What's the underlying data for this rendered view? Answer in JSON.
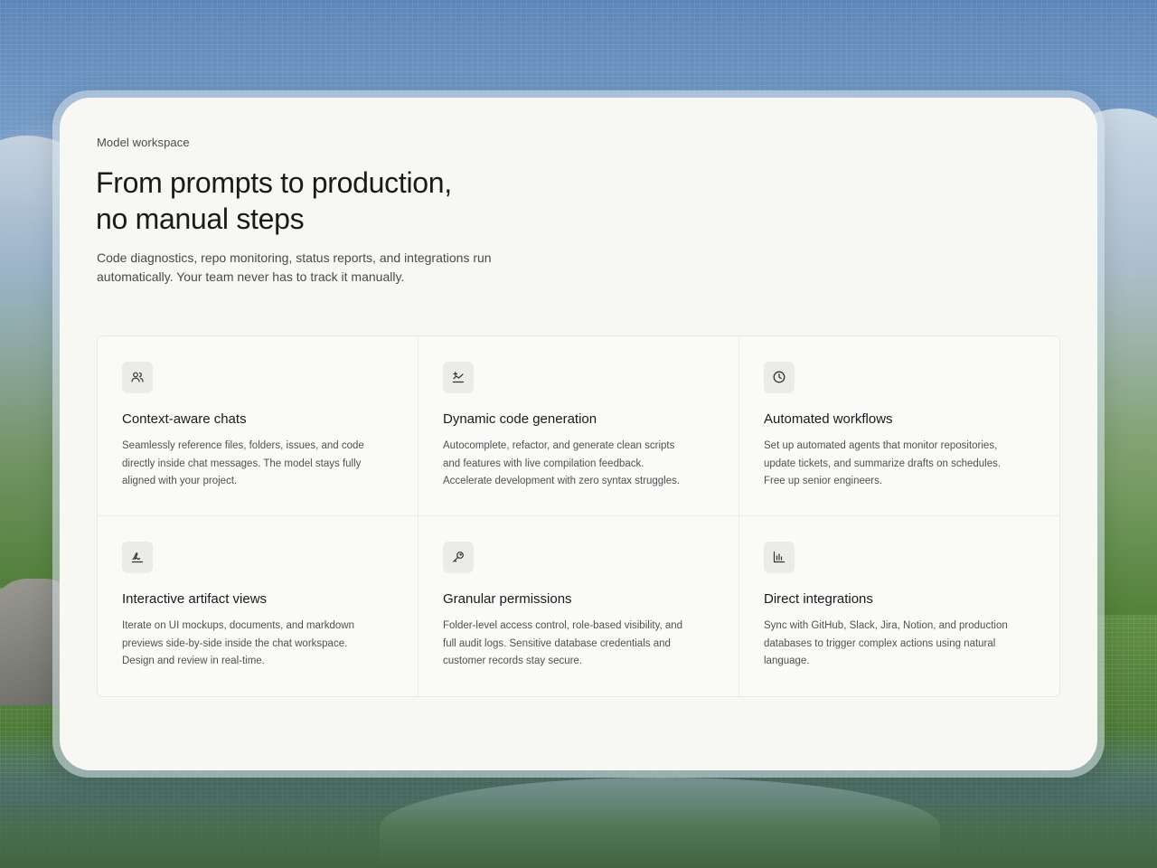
{
  "header": {
    "eyebrow": "Model workspace",
    "headline_lines": [
      "From prompts to production,",
      "no manual steps"
    ],
    "subtext_lines": [
      "Code diagnostics, repo monitoring, status reports, and integrations run",
      "automatically. Your team never has to track it manually."
    ]
  },
  "features": [
    {
      "icon": "users-icon",
      "title": "Context-aware chats",
      "desc_lines": [
        "Seamlessly reference files, folders, issues, and code",
        "directly inside chat messages. The model stays fully",
        "aligned with your project."
      ]
    },
    {
      "icon": "code-sparkle-icon",
      "title": "Dynamic code generation",
      "desc_lines": [
        "Autocomplete, refactor, and generate clean scripts",
        "and features with live compilation feedback.",
        "Accelerate development with zero syntax struggles."
      ]
    },
    {
      "icon": "clock-icon",
      "title": "Automated workflows",
      "desc_lines": [
        "Set up automated agents that monitor repositories,",
        "update tickets, and summarize drafts on schedules.",
        "Free up senior engineers."
      ]
    },
    {
      "icon": "signature-icon",
      "title": "Interactive artifact views",
      "desc_lines": [
        "Iterate on UI mockups, documents, and markdown",
        "previews side-by-side inside the chat workspace.",
        "Design and review in real-time."
      ]
    },
    {
      "icon": "key-icon",
      "title": "Granular permissions",
      "desc_lines": [
        "Folder-level access control, role-based visibility, and",
        "full audit logs. Sensitive database credentials and",
        "customer records stay secure."
      ]
    },
    {
      "icon": "bar-chart-icon",
      "title": "Direct integrations",
      "desc_lines": [
        "Sync with GitHub, Slack, Jira, Notion, and production",
        "databases to trigger complex actions using natural",
        "language."
      ]
    }
  ]
}
